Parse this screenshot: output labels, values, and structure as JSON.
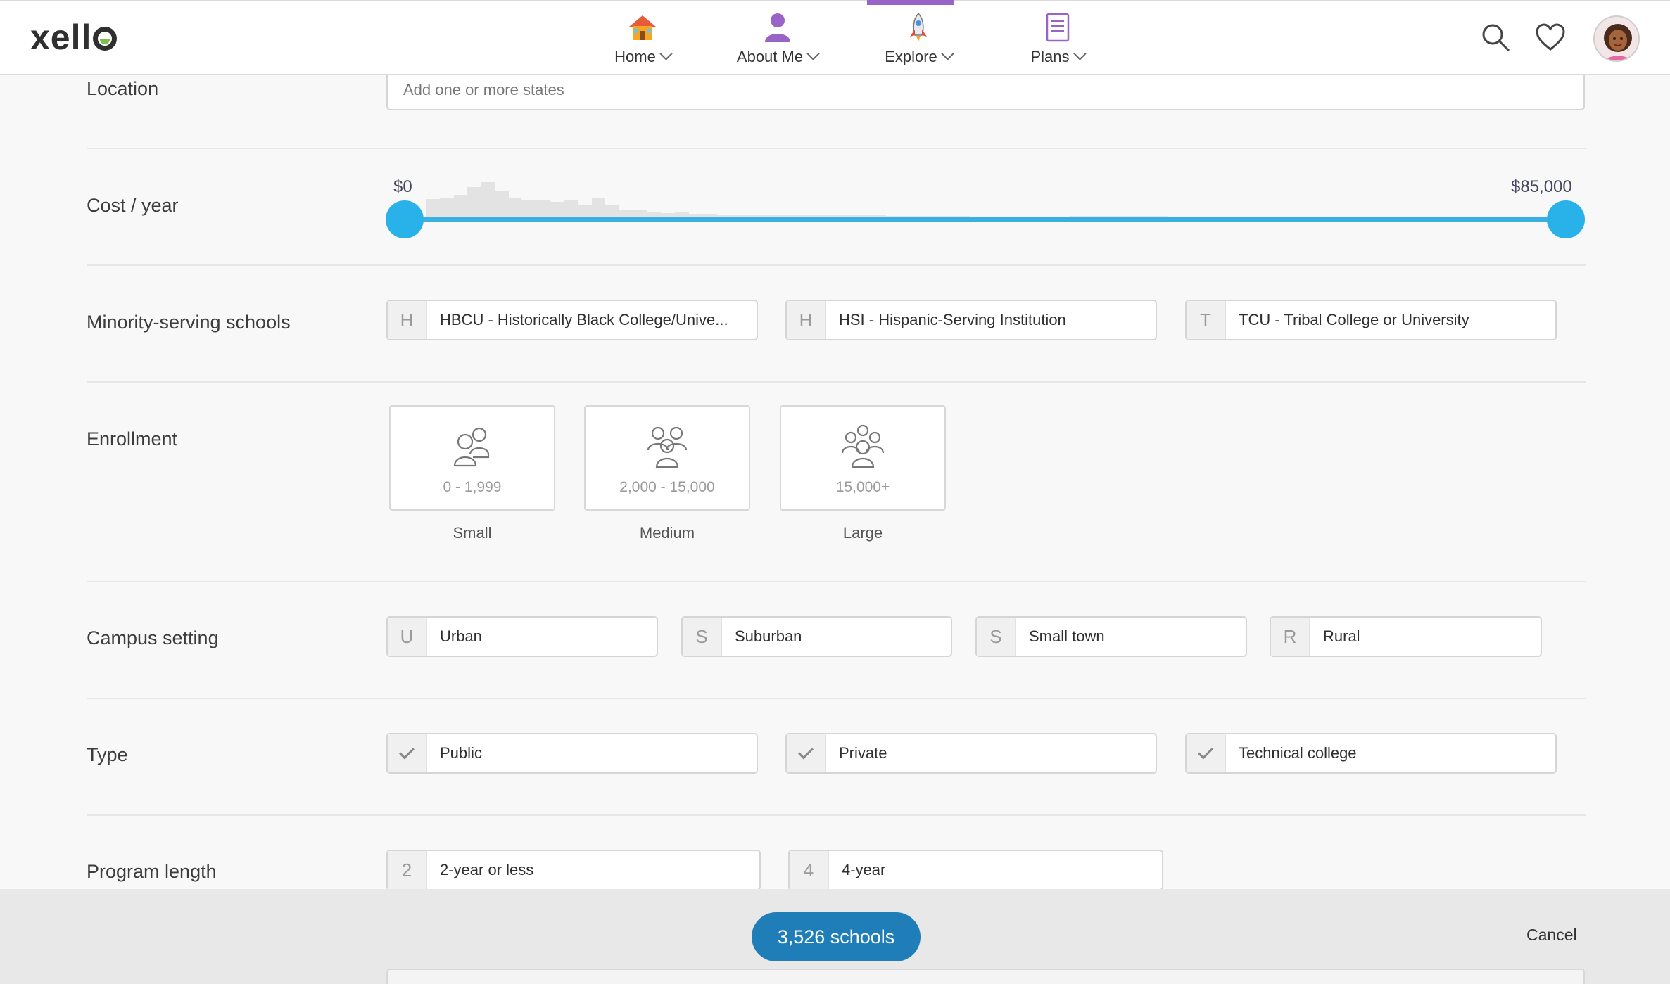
{
  "header": {
    "logo": "xello",
    "nav": [
      {
        "label": "Home",
        "icon": "house-icon"
      },
      {
        "label": "About Me",
        "icon": "person-icon"
      },
      {
        "label": "Explore",
        "icon": "rocket-icon",
        "active": true
      },
      {
        "label": "Plans",
        "icon": "clipboard-icon"
      }
    ],
    "accent": "#9a63c7"
  },
  "filters": {
    "location": {
      "label": "Location",
      "placeholder": "Add one or more states"
    },
    "cost": {
      "label": "Cost / year",
      "min": "$0",
      "max": "$85,000",
      "slider_low_fraction": 0.0,
      "slider_high_fraction": 1.0
    },
    "minority": {
      "label": "Minority-serving schools",
      "options": [
        {
          "key": "H",
          "label": "HBCU - Historically Black College/Unive..."
        },
        {
          "key": "H",
          "label": "HSI - Hispanic-Serving Institution"
        },
        {
          "key": "T",
          "label": "TCU - Tribal College or University"
        }
      ]
    },
    "enrollment": {
      "label": "Enrollment",
      "options": [
        {
          "range": "0 - 1,999",
          "caption": "Small"
        },
        {
          "range": "2,000 - 15,000",
          "caption": "Medium"
        },
        {
          "range": "15,000+",
          "caption": "Large"
        }
      ]
    },
    "campus": {
      "label": "Campus setting",
      "options": [
        {
          "key": "U",
          "label": "Urban"
        },
        {
          "key": "S",
          "label": "Suburban"
        },
        {
          "key": "S",
          "label": "Small town"
        },
        {
          "key": "R",
          "label": "Rural"
        }
      ]
    },
    "type": {
      "label": "Type",
      "options": [
        {
          "label": "Public"
        },
        {
          "label": "Private"
        },
        {
          "label": "Technical college"
        }
      ]
    },
    "program_length": {
      "label": "Program length",
      "options": [
        {
          "key": "2",
          "label": "2-year or less"
        },
        {
          "key": "4",
          "label": "4-year"
        }
      ]
    }
  },
  "footer": {
    "results_label": "3,526 schools",
    "cancel_label": "Cancel"
  },
  "colors": {
    "slider": "#29b2ea",
    "results_button": "#1f7eb8"
  }
}
